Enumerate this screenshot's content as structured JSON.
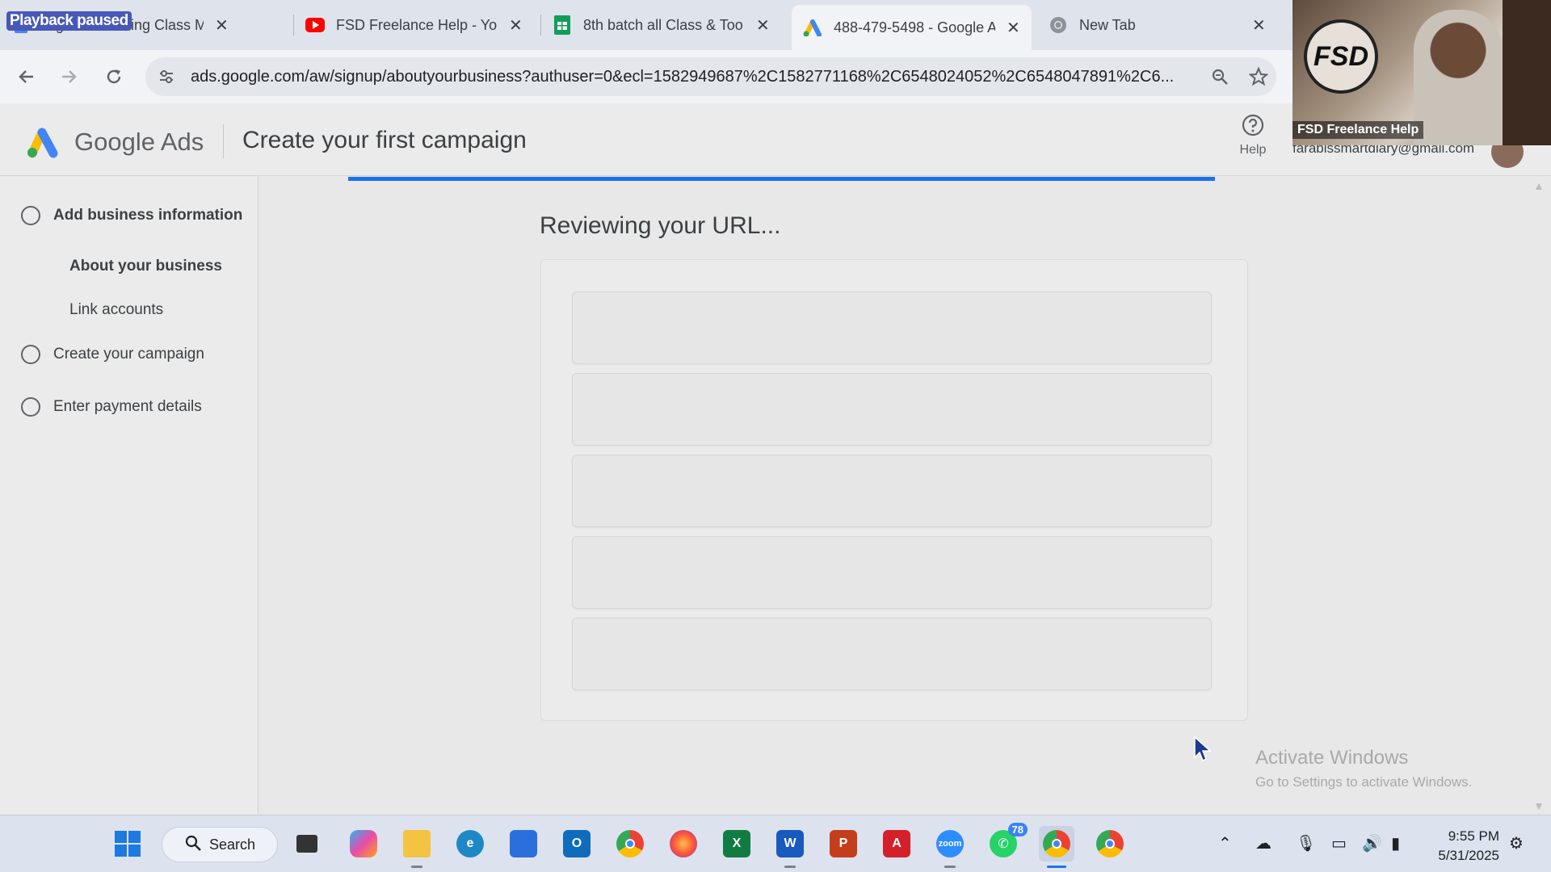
{
  "browser": {
    "paused_badge": "Playback paused",
    "tabs": [
      {
        "title": "Digital Marketing Class M",
        "icon": "docs-icon"
      },
      {
        "title": "FSD Freelance Help - You",
        "icon": "youtube-icon"
      },
      {
        "title": "8th batch all Class & Too",
        "icon": "sheets-icon"
      },
      {
        "title": "488-479-5498 - Google A",
        "icon": "google-ads-icon",
        "active": true
      },
      {
        "title": "New Tab",
        "icon": "chrome-icon"
      }
    ],
    "url": "ads.google.com/aw/signup/aboutyourbusiness?authuser=0&ecl=1582949687%2C1582771168%2C6548024052%2C6548047891%2C6..."
  },
  "ads": {
    "brand": "Google Ads",
    "page_title": "Create your first campaign",
    "help_label": "Help",
    "account_email": "farabissmartdiary@gmail.com"
  },
  "sidebar": {
    "steps": [
      {
        "label": "Add business information"
      },
      {
        "label": "About your business"
      },
      {
        "label": "Link accounts"
      },
      {
        "label": "Create your campaign"
      },
      {
        "label": "Enter payment details"
      }
    ]
  },
  "main": {
    "heading": "Reviewing your URL..."
  },
  "watermark": {
    "line1": "Activate Windows",
    "line2": "Go to Settings to activate Windows."
  },
  "webcam": {
    "logo_text": "FSD",
    "caption": "FSD Freelance Help"
  },
  "taskbar": {
    "search_label": "Search",
    "whatsapp_badge": "78",
    "time": "9:55 PM",
    "date": "5/31/2025"
  },
  "colors": {
    "accent": "#1a73e8",
    "page_bg": "#e8e8e8"
  }
}
